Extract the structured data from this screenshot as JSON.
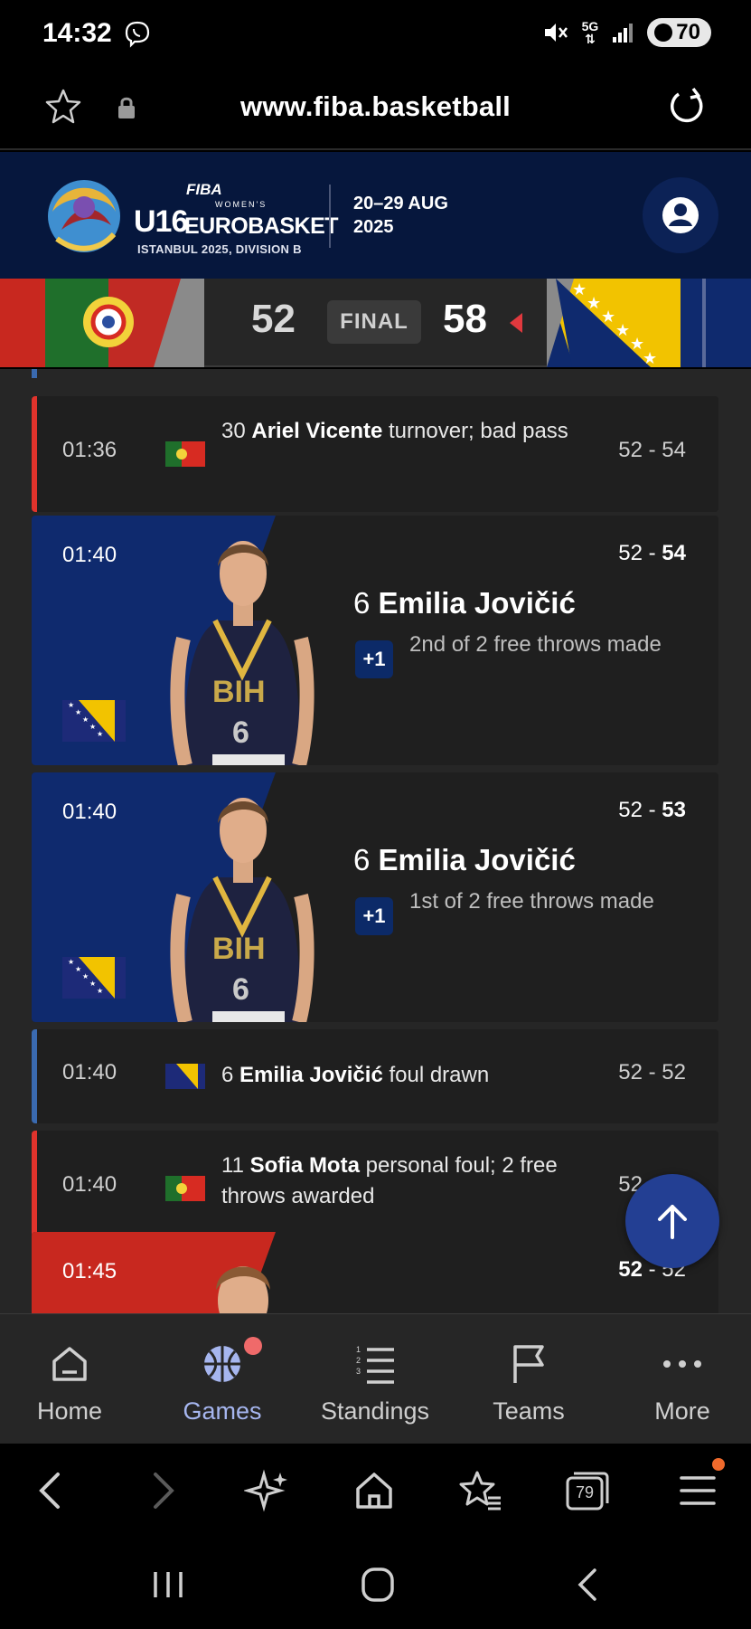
{
  "status_bar": {
    "time": "14:32",
    "network": "5G",
    "battery": "70"
  },
  "browser": {
    "url": "www.fiba.basketball",
    "tabs_count": "79"
  },
  "site_header": {
    "logo_fiba": "FIBA",
    "logo_womens": "WOMEN'S",
    "logo_u16": "U16",
    "logo_eurobasket": "EUROBASKET",
    "logo_sub": "ISTANBUL 2025, DIVISION B",
    "dates_line1": "20–29 AUG",
    "dates_line2": "2025"
  },
  "scoreboard": {
    "home_score": "52",
    "status": "FINAL",
    "away_score": "58"
  },
  "events": [
    {
      "time": "01:36",
      "number": "30",
      "player": "Ariel Vicente",
      "action": "turnover; bad pass",
      "score": "52 - 54",
      "team": "POR"
    },
    {
      "time": "01:40",
      "number": "6",
      "player": "Emilia Jovičić",
      "badge": "+1",
      "action": "2nd of 2 free throws made",
      "score_home": "52",
      "score_sep": " - ",
      "score_away": "54",
      "team": "BIH"
    },
    {
      "time": "01:40",
      "number": "6",
      "player": "Emilia Jovičić",
      "badge": "+1",
      "action": "1st of 2 free throws made",
      "score_home": "52",
      "score_sep": " - ",
      "score_away": "53",
      "team": "BIH"
    },
    {
      "time": "01:40",
      "number": "6",
      "player": "Emilia Jovičić",
      "action": "foul drawn",
      "score": "52 - 52",
      "team": "BIH"
    },
    {
      "time": "01:40",
      "number": "11",
      "player": "Sofia Mota",
      "action": "personal foul; 2 free throws awarded",
      "score": "52 - 52",
      "team": "POR"
    },
    {
      "time": "01:45",
      "score_home": "52",
      "score_sep": " - ",
      "score_away": "52",
      "team": "POR"
    }
  ],
  "site_nav": [
    {
      "label": "Home",
      "icon": "home-icon"
    },
    {
      "label": "Games",
      "icon": "basketball-icon"
    },
    {
      "label": "Standings",
      "icon": "list-icon"
    },
    {
      "label": "Teams",
      "icon": "flag-icon"
    },
    {
      "label": "More",
      "icon": "more-icon"
    }
  ],
  "colors": {
    "header_navy": "#06173d",
    "portugal_red": "#d72b22",
    "bih_blue": "#0f2a6e",
    "active_nav": "#a6b6ef",
    "fab_blue": "#233f93"
  }
}
